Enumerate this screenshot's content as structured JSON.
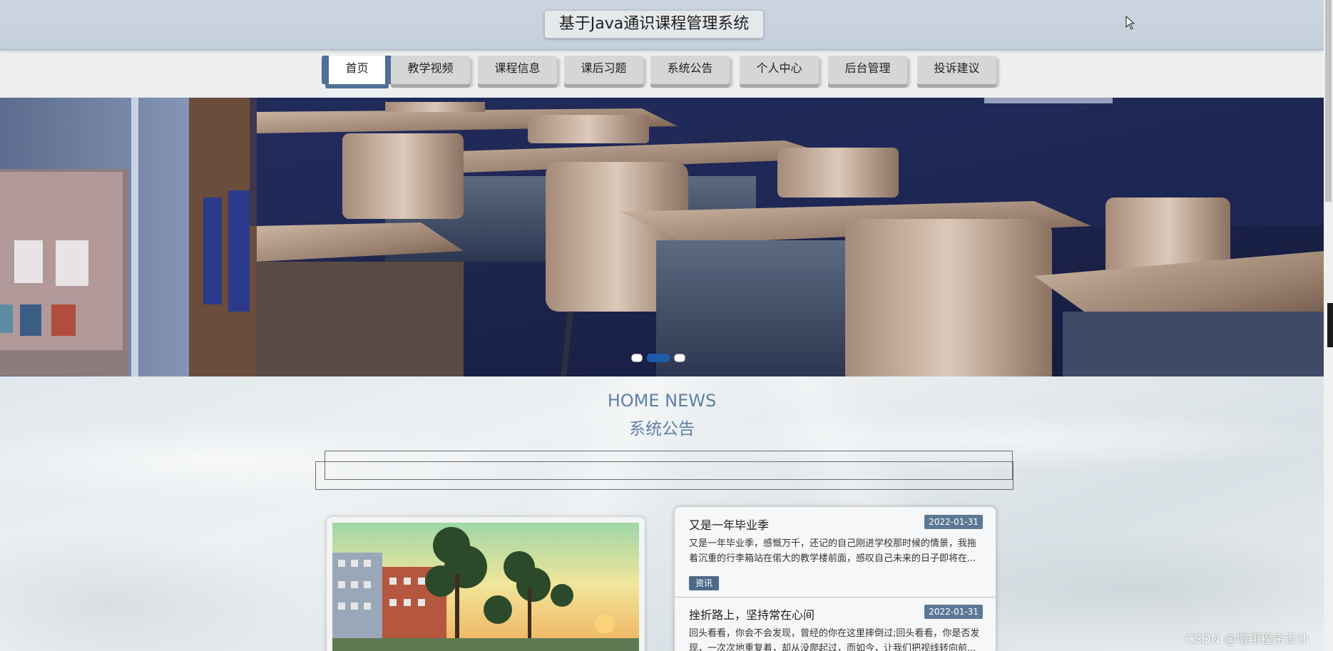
{
  "header": {
    "title": "基于Java通识课程管理系统"
  },
  "nav": {
    "items": [
      {
        "label": "首页",
        "active": true
      },
      {
        "label": "教学视频",
        "active": false
      },
      {
        "label": "课程信息",
        "active": false
      },
      {
        "label": "课后习题",
        "active": false
      },
      {
        "label": "系统公告",
        "active": false
      },
      {
        "label": "个人中心",
        "active": false
      },
      {
        "label": "后台管理",
        "active": false
      },
      {
        "label": "投诉建议",
        "active": false
      }
    ]
  },
  "carousel": {
    "slide_count": 3,
    "active_index": 1
  },
  "news_section": {
    "title_en": "HOME NEWS",
    "title_cn": "系统公告"
  },
  "news": [
    {
      "title": "又是一年毕业季",
      "date": "2022-01-31",
      "summary": "又是一年毕业季，感慨万千，还记的自己刚进学校那时候的情景，我拖着沉重的行李箱站在偌大的教学楼前面，感叹自己未来的日子即将在...",
      "tag": "资讯"
    },
    {
      "title": "挫折路上，坚持常在心间",
      "date": "2022-01-31",
      "summary": "回头看看，你会不会发现，曾经的你在这里摔倒过;回头看看，你是否发现，一次次地重复着，却从没爬起过，而如今，让我们把视线转向前..."
    }
  ],
  "watermark": "CSDN @增翔程序设计",
  "colors": {
    "accent": "#4f6f96",
    "header_bg": "#c3cfdb",
    "section_title": "#5f7fa6",
    "date_badge": "#5d7896"
  }
}
